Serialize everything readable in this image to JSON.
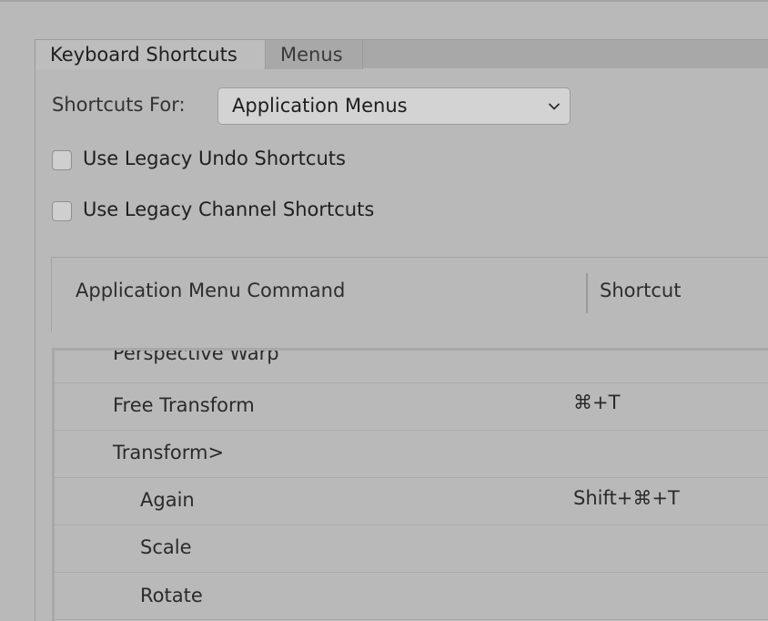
{
  "tabs": {
    "keyboard_shortcuts": "Keyboard Shortcuts",
    "menus": "Menus"
  },
  "shortcuts_for": {
    "label": "Shortcuts For:",
    "value": "Application Menus"
  },
  "options": {
    "legacy_undo": "Use Legacy Undo Shortcuts",
    "legacy_channel": "Use Legacy Channel Shortcuts"
  },
  "table": {
    "columns": {
      "command": "Application Menu Command",
      "shortcut": "Shortcut"
    },
    "rows": [
      {
        "command": "Perspective Warp",
        "shortcut": "",
        "indent": 0
      },
      {
        "command": "Free Transform",
        "shortcut": "⌘+T",
        "indent": 0
      },
      {
        "command": "Transform>",
        "shortcut": "",
        "indent": 0
      },
      {
        "command": "Again",
        "shortcut": "Shift+⌘+T",
        "indent": 1
      },
      {
        "command": "Scale",
        "shortcut": "",
        "indent": 1
      },
      {
        "command": "Rotate",
        "shortcut": "",
        "indent": 1
      }
    ]
  }
}
